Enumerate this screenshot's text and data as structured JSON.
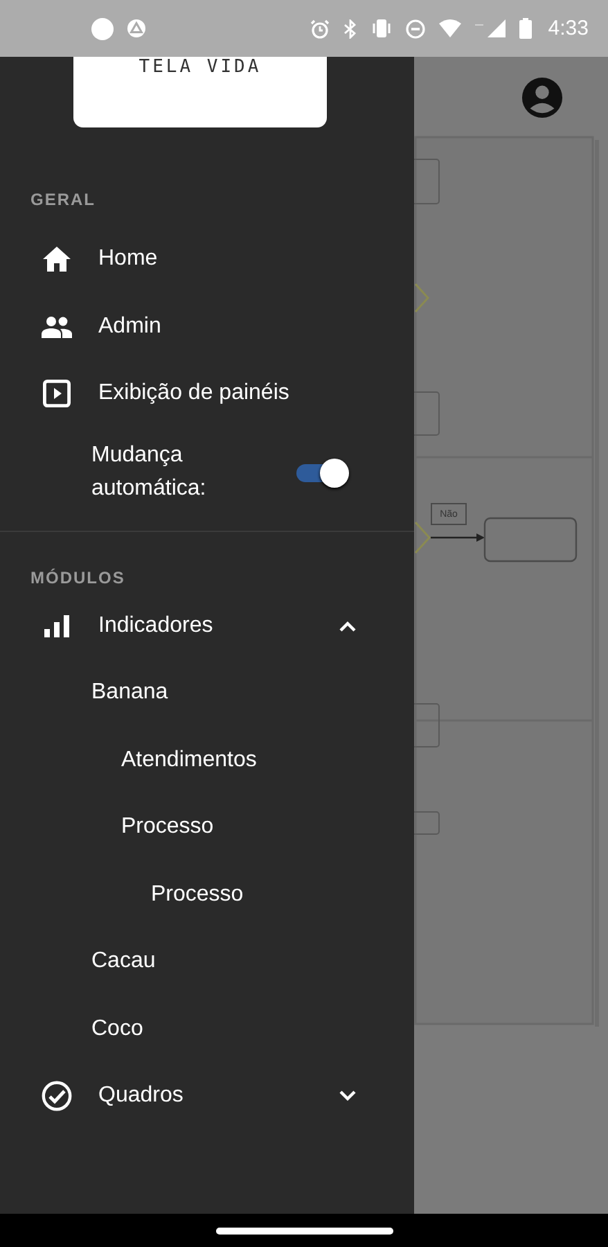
{
  "status_bar": {
    "time": "4:33"
  },
  "logo": {
    "text": "TELA VIDA"
  },
  "general": {
    "title": "GERAL",
    "items": [
      {
        "kind": "link",
        "label": "Home"
      },
      {
        "kind": "link",
        "label": "Admin"
      },
      {
        "kind": "link",
        "label": "Exibição de painéis"
      },
      {
        "kind": "toggle",
        "label": "Mudança automática:",
        "on": true
      }
    ]
  },
  "modules": {
    "title": "MÓDULOS",
    "items": [
      {
        "label": "Indicadores",
        "expanded": true,
        "children": [
          {
            "label": "Banana",
            "children": [
              {
                "label": "Atendimentos"
              },
              {
                "label": "Processo",
                "children": [
                  {
                    "label": "Processo"
                  }
                ]
              }
            ]
          },
          {
            "label": "Cacau"
          },
          {
            "label": "Coco"
          }
        ]
      },
      {
        "label": "Quadros",
        "expanded": false
      }
    ]
  },
  "background": {
    "diagram_label": "Não"
  }
}
